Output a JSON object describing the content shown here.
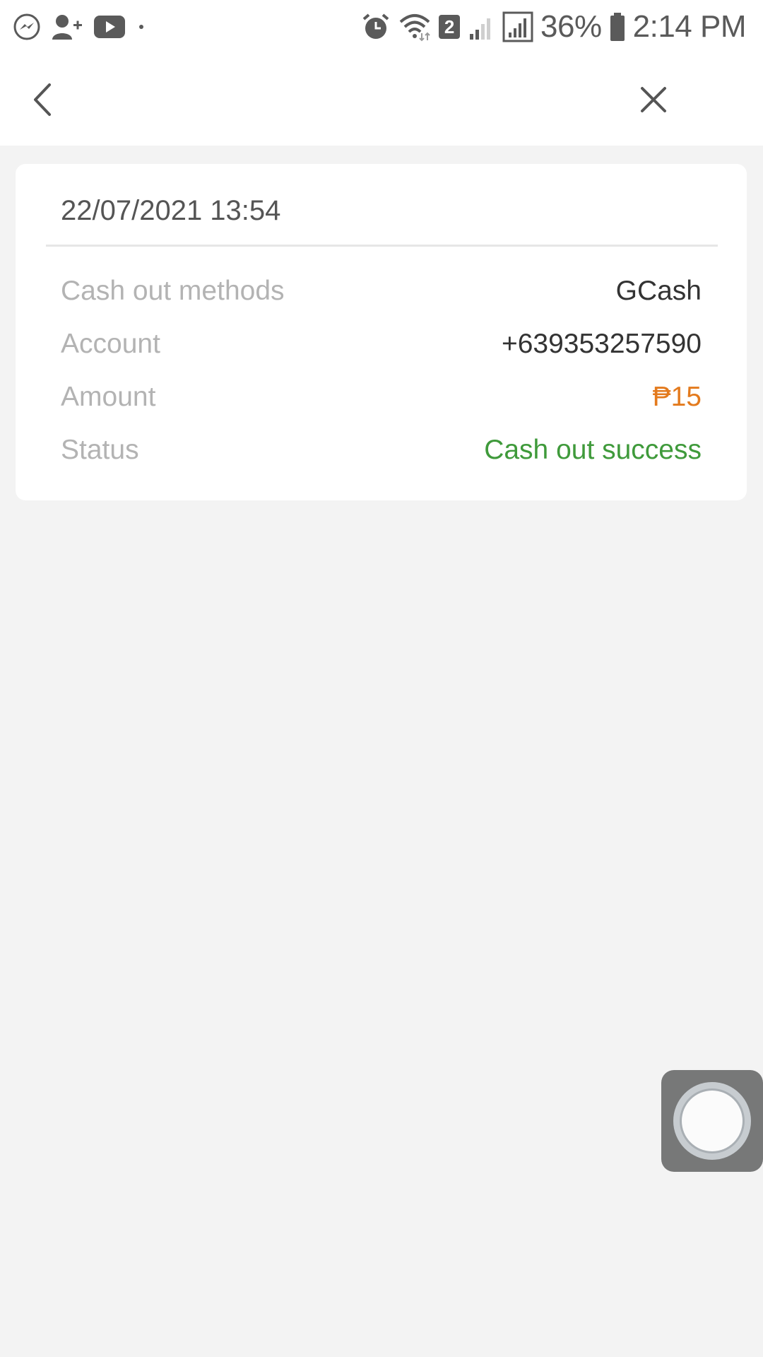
{
  "status_bar": {
    "battery_percent": "36%",
    "time": "2:14 PM",
    "notification_count": "2",
    "left_icons": [
      "messenger-icon",
      "add-person-icon",
      "youtube-icon",
      "dot-icon"
    ],
    "right_icons": [
      "alarm-icon",
      "wifi-icon",
      "sim-2-badge",
      "signal-weak-icon",
      "signal-icon",
      "battery-icon"
    ]
  },
  "nav": {
    "back_icon": "chevron-left-icon",
    "close_icon": "close-icon"
  },
  "record": {
    "datetime": "22/07/2021 13:54",
    "rows": [
      {
        "label": "Cash out methods",
        "value": "GCash"
      },
      {
        "label": "Account",
        "value": "+639353257590"
      },
      {
        "label": "Amount",
        "value": "₱15"
      },
      {
        "label": "Status",
        "value": "Cash out success"
      }
    ]
  },
  "colors": {
    "amount": "#e37a1d",
    "status_success": "#3f9a3b",
    "label": "#b3b3b3",
    "background": "#f3f3f3"
  }
}
